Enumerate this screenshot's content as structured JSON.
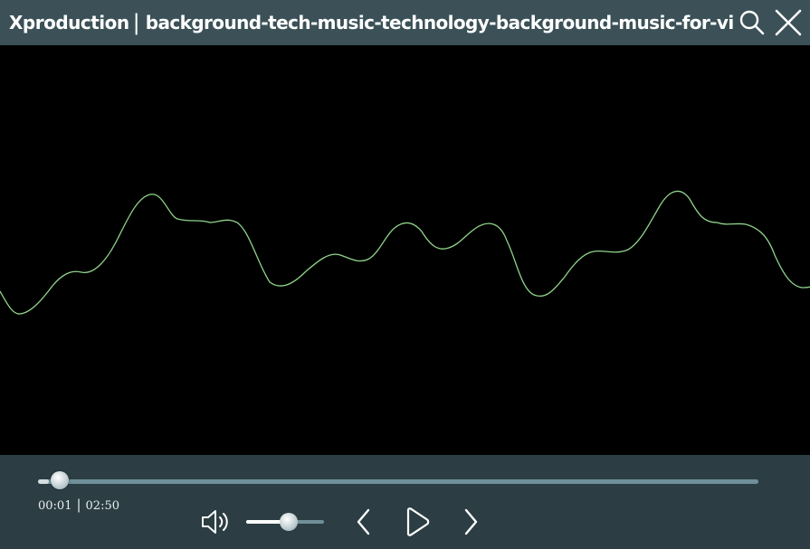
{
  "titlebar": {
    "app_name": "Xproduction",
    "separator": "|",
    "track_title": "background-tech-music-technology-background-music-for-vide",
    "search_icon": "search-icon",
    "close_icon": "close-icon"
  },
  "visualizer": {
    "wave_color": "#8fd48a"
  },
  "player": {
    "current_time": "00:01",
    "time_separator": "|",
    "duration": "02:50",
    "progress_fraction": 0.015,
    "volume_fraction": 0.55,
    "volume_icon": "speaker-icon",
    "prev_icon": "chevron-left-icon",
    "play_icon": "play-icon",
    "next_icon": "chevron-right-icon"
  },
  "colors": {
    "titlebar_bg": "#3b5157",
    "controls_bg": "#2c3e43",
    "track": "#6f8f9a"
  }
}
